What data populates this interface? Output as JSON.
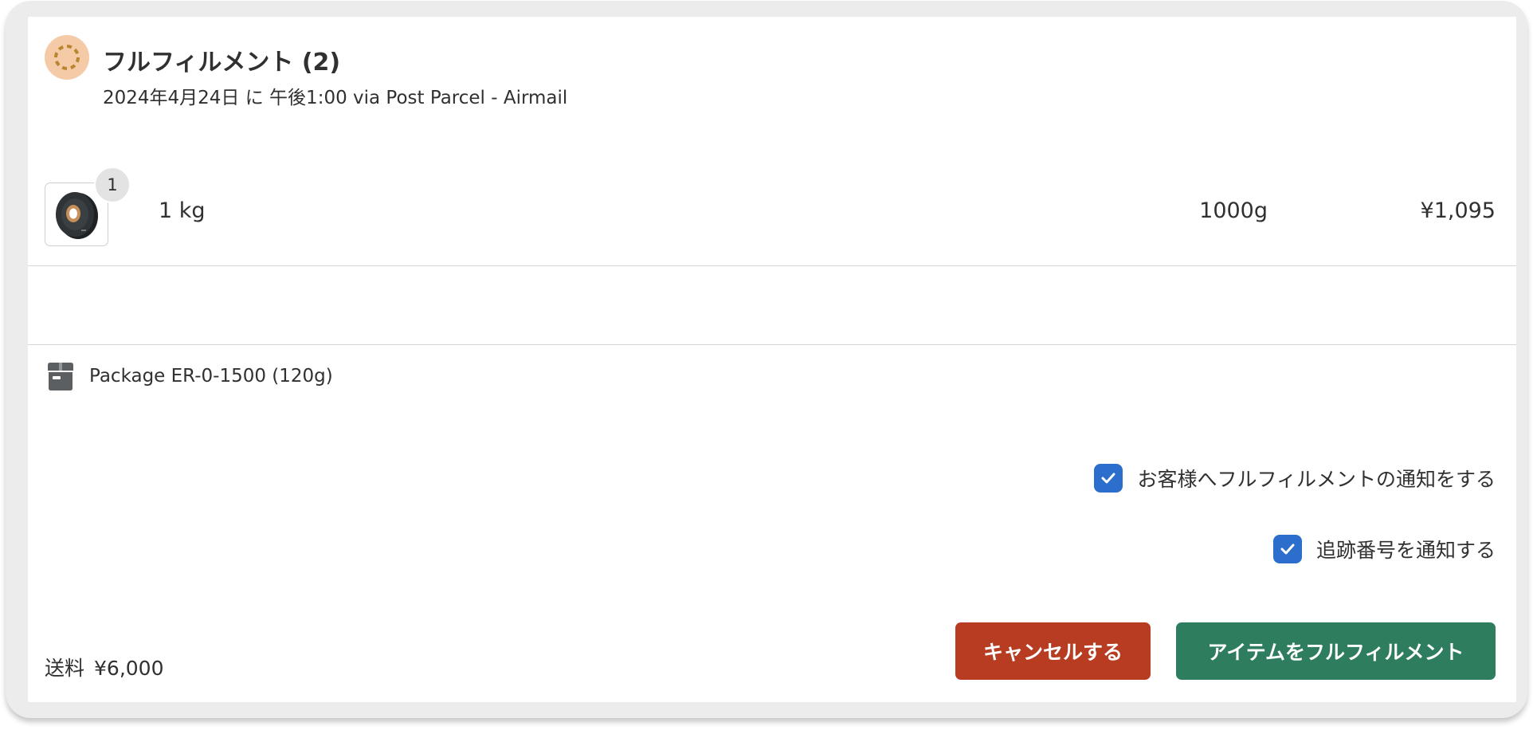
{
  "colors": {
    "status_icon_bg": "#f5cba7",
    "status_icon_dash": "#b8862e",
    "checkbox": "#2c6ecb",
    "cancel_button": "#b73c22",
    "fulfill_button": "#2e7d5e"
  },
  "header": {
    "status_icon": "in-progress-icon",
    "title": "フルフィルメント (2)",
    "subtitle": "2024年4月24日 に 午後1:00 via Post Parcel - Airmail"
  },
  "line_item": {
    "image_icon": "weight-plate-thumbnail",
    "quantity": "1",
    "name": "1 kg",
    "weight": "1000g",
    "price": "¥1,095"
  },
  "package": {
    "icon": "package-icon",
    "label": "Package ER-0-1500 (120g)"
  },
  "options": [
    {
      "label": "お客様へフルフィルメントの通知をする",
      "checked": true
    },
    {
      "label": "追跡番号を通知する",
      "checked": true
    }
  ],
  "shipping": {
    "label": "送料",
    "amount": "¥6,000"
  },
  "actions": {
    "cancel_label": "キャンセルする",
    "fulfill_label": "アイテムをフルフィルメント"
  }
}
